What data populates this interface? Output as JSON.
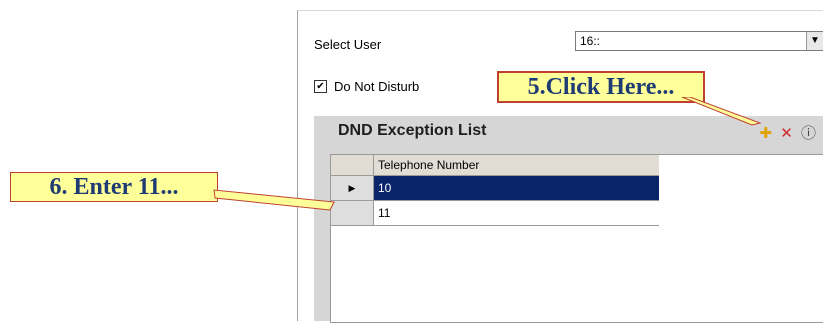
{
  "form": {
    "select_user_label": "Select User",
    "select_user_value": "16::",
    "do_not_disturb_label": "Do Not Disturb",
    "do_not_disturb_checked": true
  },
  "dnd": {
    "title": "DND Exception List",
    "column_header": "Telephone Number",
    "rows": [
      "10",
      "11"
    ]
  },
  "annotations": {
    "step5": "5.Click Here...",
    "step6": "6. Enter 11..."
  },
  "icons": [
    "new-item-icon",
    "delete-icon",
    "help-icon",
    "dropdown-arrow-icon",
    "row-selector-arrow-icon"
  ],
  "colors": {
    "selected_row": "#0a246a",
    "callout_bg": "#ffff99",
    "callout_text": "#1f3b73",
    "callout_border": "#c04030"
  }
}
